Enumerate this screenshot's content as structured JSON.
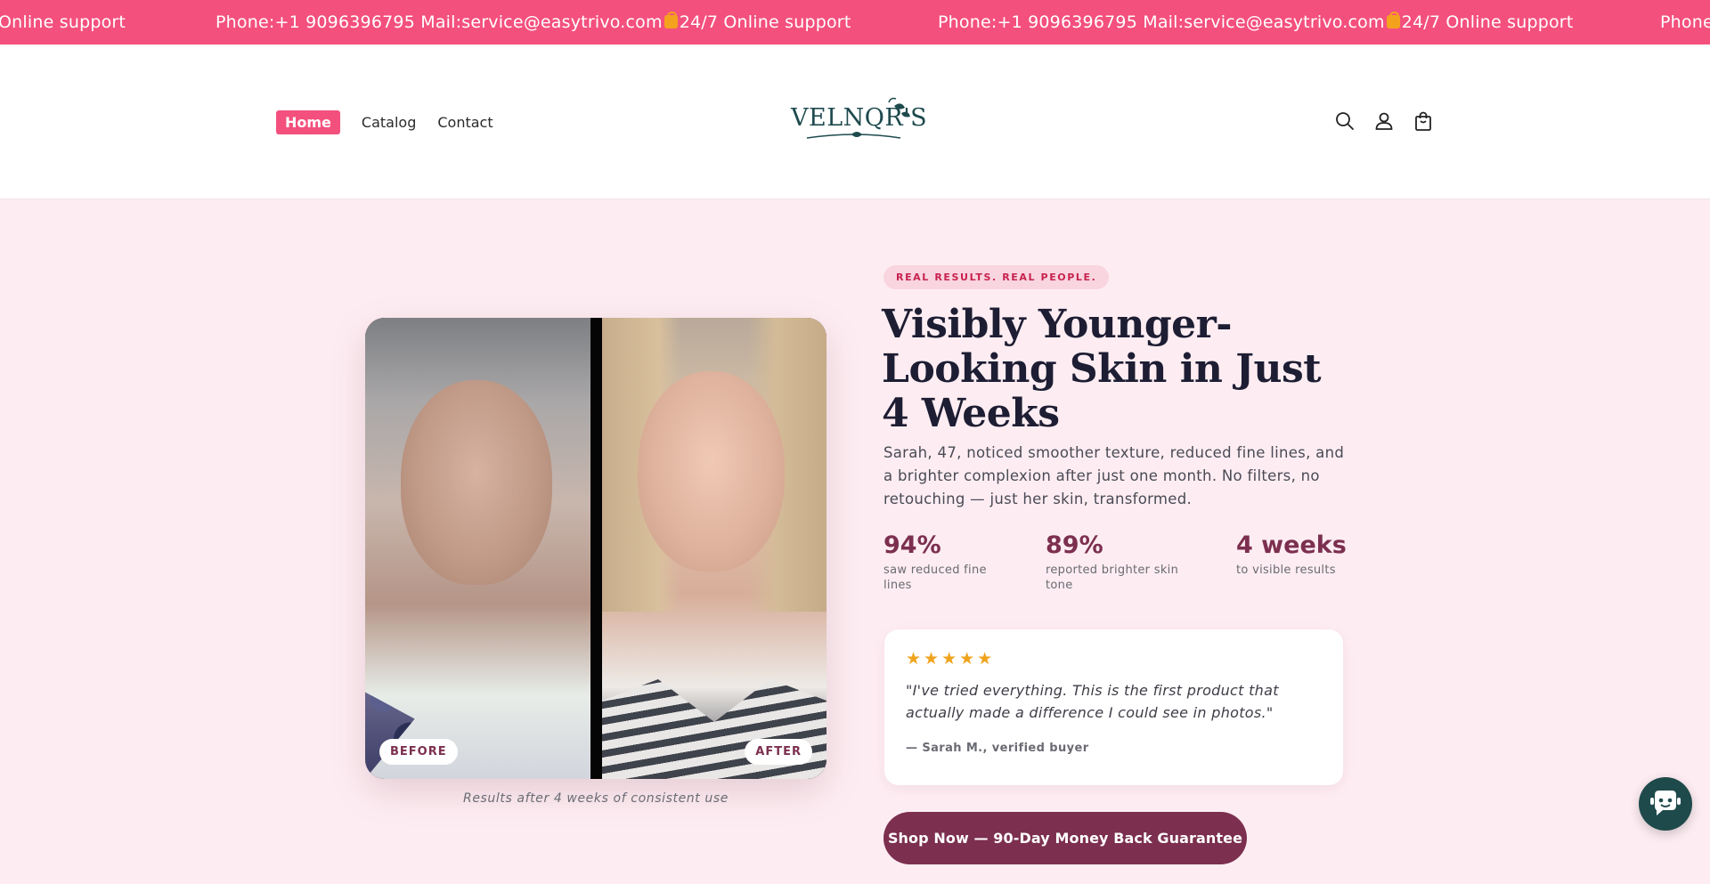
{
  "announcement": {
    "segment_tail": "Online support",
    "phone": "Phone:+1 9096396795",
    "mail": "Mail:service@easytrivo.com",
    "support": "24/7 Online support",
    "segment_head": "Phone"
  },
  "nav": {
    "items": [
      {
        "label": "Home",
        "active": true
      },
      {
        "label": "Catalog",
        "active": false
      },
      {
        "label": "Contact",
        "active": false
      }
    ]
  },
  "brand": {
    "logo_text": "VELNQR'S"
  },
  "header_icons": [
    "search-icon",
    "account-icon",
    "cart-icon"
  ],
  "hero": {
    "tag": "REAL RESULTS. REAL PEOPLE.",
    "headline": "Visibly Younger-Looking Skin in Just 4 Weeks",
    "subtext": "Sarah, 47, noticed smoother texture, reduced fine lines, and a brighter complexion after just one month. No filters, no retouching — just her skin, transformed.",
    "before_label": "BEFORE",
    "after_label": "AFTER",
    "caption": "Results after 4 weeks of consistent use",
    "stats": [
      {
        "value": "94%",
        "label": "saw reduced fine lines"
      },
      {
        "value": "89%",
        "label": "reported brighter skin tone"
      },
      {
        "value": "4 weeks",
        "label": "to visible results"
      }
    ],
    "review": {
      "stars": "★★★★★",
      "rating": 5,
      "quote": "\"I've tried everything. This is the first product that actually made a difference I could see in photos.\"",
      "author": "— Sarah M., verified buyer"
    },
    "cta_label": "Shop Now — 90-Day Money Back Guarantee"
  },
  "colors": {
    "announcement_bg": "#f4507d",
    "page_bg": "#fdedf2",
    "accent": "#7c2f4f",
    "star": "#f0a41e",
    "logo": "#1e4a4e"
  }
}
